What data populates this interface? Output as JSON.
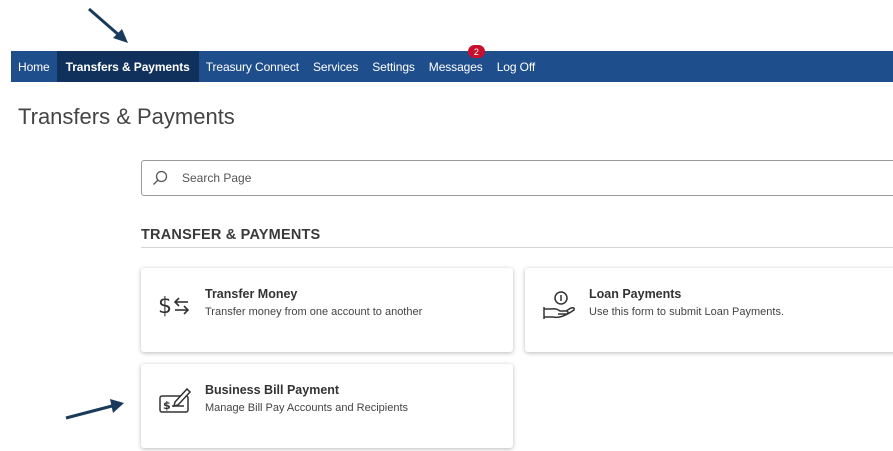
{
  "nav": {
    "items": [
      {
        "label": "Home"
      },
      {
        "label": "Transfers & Payments"
      },
      {
        "label": "Treasury Connect"
      },
      {
        "label": "Services"
      },
      {
        "label": "Settings"
      },
      {
        "label": "Messages",
        "badge": "2"
      },
      {
        "label": "Log Off"
      }
    ],
    "active": "Transfers & Payments",
    "background": "#1f4e8c",
    "active_background": "#10315c"
  },
  "page": {
    "title": "Transfers & Payments"
  },
  "search": {
    "placeholder": "Search Page",
    "value": ""
  },
  "section": {
    "heading": "TRANSFER & PAYMENTS"
  },
  "cards": [
    {
      "title": "Transfer Money",
      "description": "Transfer money from one account to another",
      "icon": "dollar-transfer-icon"
    },
    {
      "title": "Loan Payments",
      "description": "Use this form to submit Loan Payments.",
      "icon": "hand-coin-icon"
    },
    {
      "title": "Business Bill Payment",
      "description": "Manage Bill Pay Accounts and Recipients",
      "icon": "check-pen-icon"
    }
  ],
  "annotation_color": "#1a3a5c"
}
